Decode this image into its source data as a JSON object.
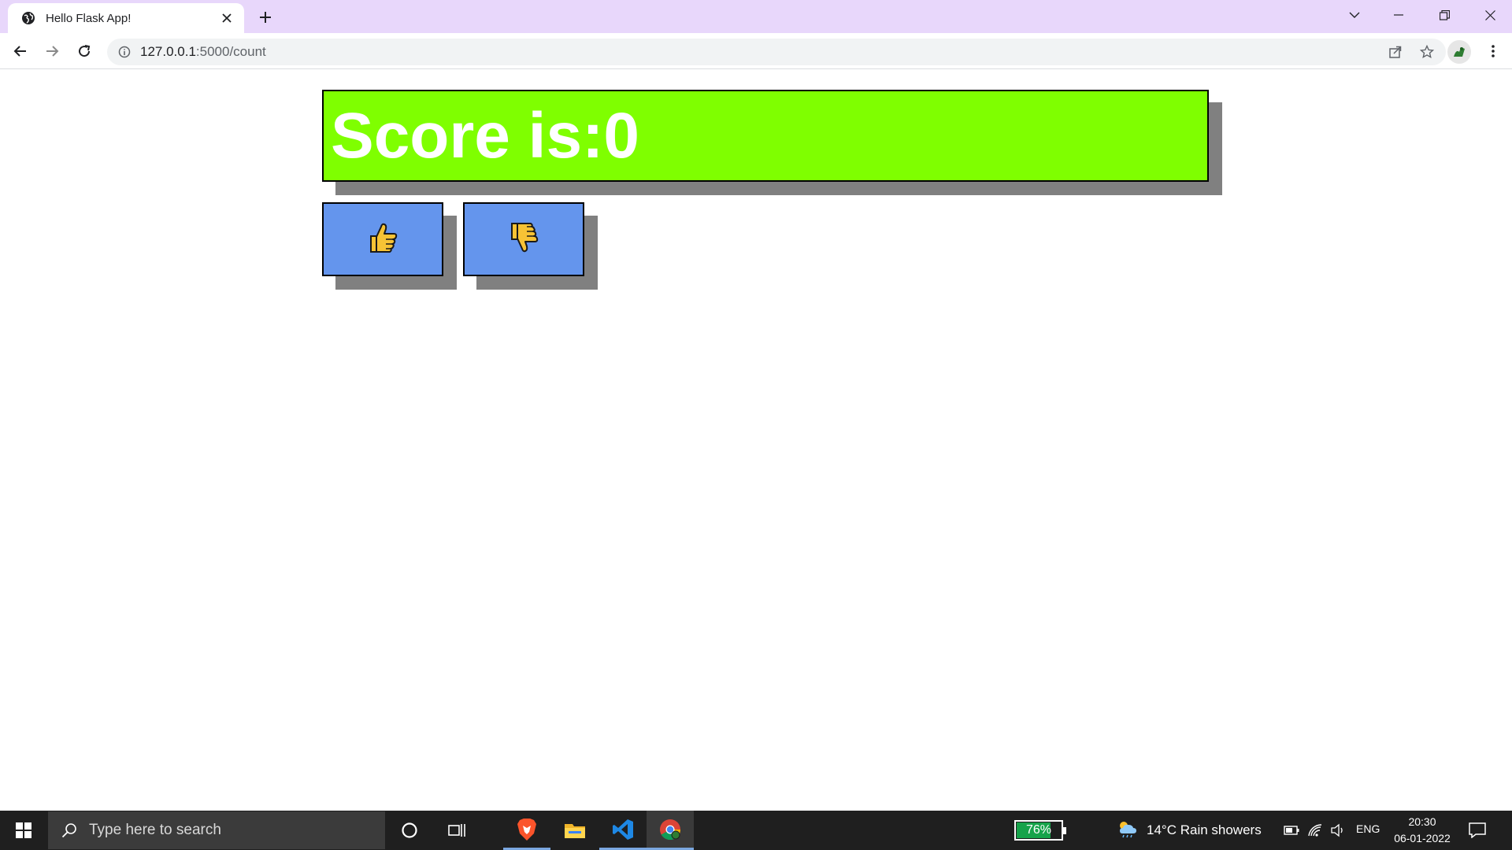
{
  "browser": {
    "tab_title": "Hello Flask App!",
    "url_host": "127.0.0.1",
    "url_path": ":5000/count"
  },
  "page": {
    "score_text": "Score is:0",
    "colors": {
      "score_background": "#7fff00",
      "score_text": "#ffffff",
      "button_background": "#6495ed",
      "shadow": "#808080"
    },
    "buttons": [
      {
        "icon": "thumbs-up-icon"
      },
      {
        "icon": "thumbs-down-icon"
      }
    ]
  },
  "taskbar": {
    "search_placeholder": "Type here to search",
    "battery_percent": "76%",
    "battery_level": 0.76,
    "weather": "14°C  Rain showers",
    "language": "ENG",
    "time": "20:30",
    "date": "06-01-2022"
  }
}
